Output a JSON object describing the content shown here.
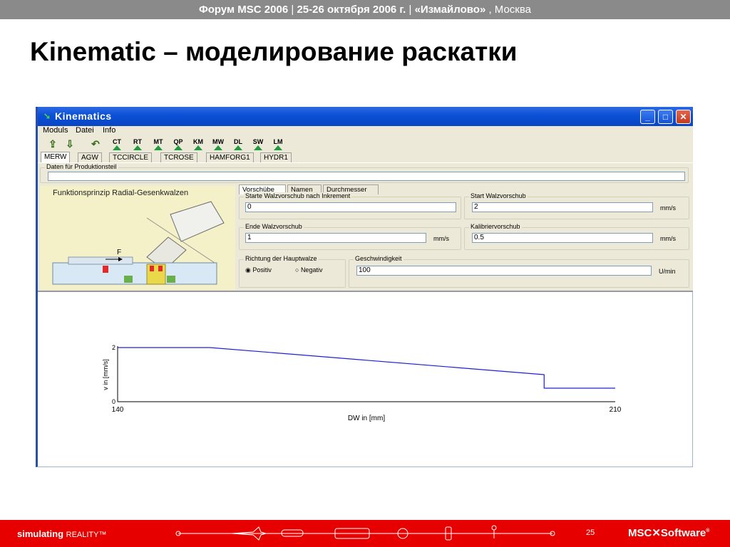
{
  "header": {
    "forum": "Форум MSC 2006",
    "dates": "25-26 октября 2006 г.",
    "venue": "«Измайлово»",
    "city": ", Москва",
    "separator": "|"
  },
  "slide_title": "Kinematic – моделирование раскатки",
  "window": {
    "title": "Kinematics",
    "menu": [
      "Moduls",
      "Datei",
      "Info"
    ],
    "toolbar": [
      "CT",
      "RT",
      "MT",
      "QP",
      "KM",
      "MW",
      "DL",
      "SW",
      "LM"
    ],
    "tabs": [
      "MERW",
      "AGW",
      "TCCIRCLE",
      "TCROSE",
      "HAMFORG1",
      "HYDR1"
    ],
    "active_tab": "MERW",
    "produktionsteil_label": "Daten für Produktionsteil",
    "produktionsteil_value": "",
    "illustration_title": "Funktionsprinzip Radial-Gesenkwalzen",
    "illustration_force_label": "F",
    "subtabs": [
      "Vorschübe",
      "Namen",
      "Durchmesser"
    ],
    "active_subtab": "Vorschübe",
    "fields": {
      "start_increment_label": "Starte Walzvorschub nach Inkrement",
      "start_increment_value": "0",
      "start_walz_label": "Start Walzvorschub",
      "start_walz_value": "2",
      "start_walz_unit": "mm/s",
      "ende_label": "Ende Walzvorschub",
      "ende_value": "1",
      "ende_unit": "mm/s",
      "kalibrier_label": "Kalibriervorschub",
      "kalibrier_value": "0.5",
      "kalibrier_unit": "mm/s",
      "richtung_label": "Richtung der Hauptwalze",
      "radio_positiv": "Positiv",
      "radio_negativ": "Negativ",
      "radio_selected": "Positiv",
      "geschw_label": "Geschwindigkeit",
      "geschw_value": "100",
      "geschw_unit": "U/min"
    }
  },
  "chart_data": {
    "type": "line",
    "xlabel": "DW in [mm]",
    "ylabel": "v in [mm/s]",
    "xlim": [
      140,
      210
    ],
    "ylim": [
      0,
      2
    ],
    "x_ticks": [
      "140",
      "210"
    ],
    "y_ticks": [
      "0",
      "2"
    ],
    "grid": false,
    "series": [
      {
        "x": [
          140,
          153,
          200,
          200,
          210
        ],
        "y": [
          2,
          2,
          1,
          0.5,
          0.5
        ],
        "color": "#2020d0"
      }
    ]
  },
  "footer": {
    "tagline": "simulating",
    "tagline2": "REALITY™",
    "page_number": "25",
    "logo": "MSC",
    "logo2": "Software",
    "logo_mark": "®"
  },
  "colors": {
    "footer_red": "#e60000",
    "topbar_gray": "#8a8a8a",
    "titlebar_blue": "#0a4fd6"
  }
}
